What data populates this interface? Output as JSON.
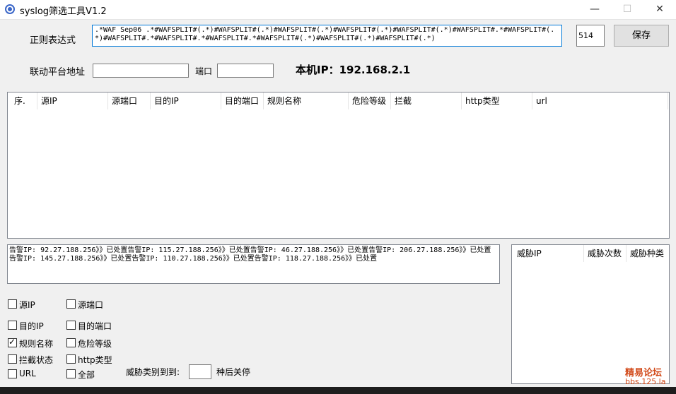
{
  "window": {
    "title": "syslog筛选工具V1.2",
    "minimize": "—",
    "maximize": "☐",
    "close": "✕"
  },
  "form": {
    "regex_label": "正则表达式",
    "regex_value": ".*WAF Sep06 .*#WAFSPLIT#(.*)#WAFSPLIT#(.*)#WAFSPLIT#(.*)#WAFSPLIT#(.*)#WAFSPLIT#(.*)#WAFSPLIT#.*#WAFSPLIT#(.*)#WAFSPLIT#.*#WAFSPLIT#.*#WAFSPLIT#.*#WAFSPLIT#(.*)#WAFSPLIT#(.*)#WAFSPLIT#(.*)",
    "port_value": "514",
    "save_label": "保存",
    "linkage_label": "联动平台地址",
    "linkage_value": "",
    "port_label": "端口",
    "linkage_port_value": "",
    "local_ip_label": "本机IP：192.168.2.1"
  },
  "main_table": {
    "columns": [
      "序.",
      "源IP",
      "源端口",
      "目的IP",
      "目的端口",
      "规则名称",
      "危险等级",
      "拦截",
      "http类型",
      "url"
    ]
  },
  "log": {
    "text": "告警IP: 92.27.188.256》》已处置告警IP: 115.27.188.256》》已处置告警IP: 46.27.188.256》》已处置告警IP: 206.27.188.256》》已处置告警IP: 145.27.188.256》》已处置告警IP: 110.27.188.256》》已处置告警IP: 118.27.188.256》》已处置"
  },
  "threat_table": {
    "columns": [
      "威胁IP",
      "威胁次数",
      "威胁种类"
    ]
  },
  "filters": [
    {
      "label": "源IP",
      "checked": false
    },
    {
      "label": "源端口",
      "checked": false
    },
    {
      "label": "目的IP",
      "checked": false
    },
    {
      "label": "目的端口",
      "checked": false
    },
    {
      "label": "规则名称",
      "checked": true
    },
    {
      "label": "危险等级",
      "checked": false
    },
    {
      "label": "拦截状态",
      "checked": false
    },
    {
      "label": "http类型",
      "checked": false
    },
    {
      "label": "URL",
      "checked": false
    },
    {
      "label": "全部",
      "checked": false
    }
  ],
  "auto_block": {
    "prefix": "威胁类别到到:",
    "value": "",
    "suffix": "种后关停"
  },
  "watermark": {
    "line1": "精易论坛",
    "line2": "bbs.125.la"
  }
}
